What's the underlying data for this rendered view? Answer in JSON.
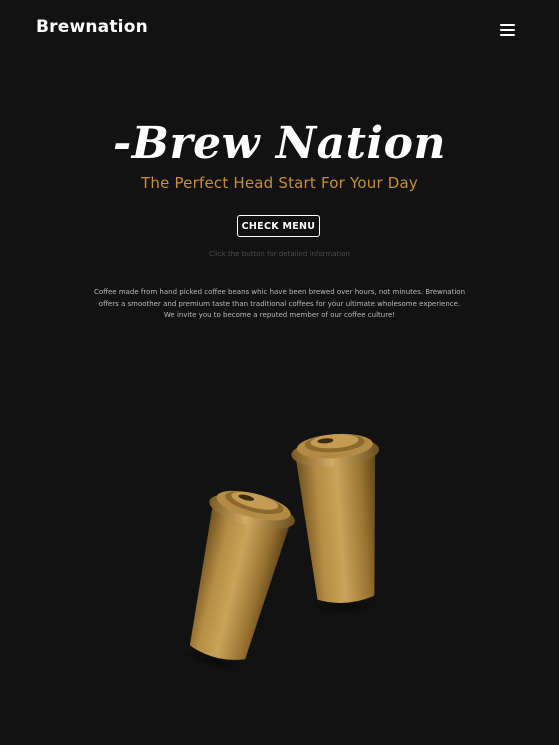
{
  "header": {
    "brand": "Brewnation",
    "menu_icon": "hamburger-menu-icon"
  },
  "hero": {
    "title": "-Brew Nation",
    "subtitle": "The Perfect Head Start For Your Day",
    "cta_label": "CHECK MENU",
    "hint": "Click the button for detailed information",
    "description": [
      "Coffee made from hand picked coffee beans whic have been brewed over hours, not minutes. Brewnation",
      "offers a smoother and premium taste than traditional coffees for your ultimate wholesome experience.",
      "We invite you to become a reputed member of our coffee culture!"
    ],
    "image": "coffee-cups-illustration"
  },
  "colors": {
    "background": "#121212",
    "accent": "#c98f33",
    "cup": "#a27a35"
  }
}
